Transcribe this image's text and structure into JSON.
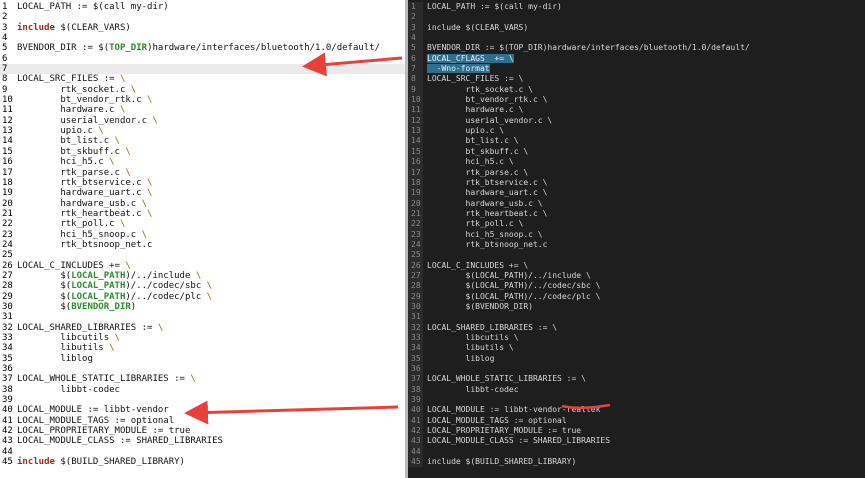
{
  "left_lines": [
    {
      "n": "1",
      "segs": [
        {
          "t": "LOCAL_PATH := $(call my-dir)",
          "c": ""
        }
      ]
    },
    {
      "n": "2",
      "segs": []
    },
    {
      "n": "3",
      "segs": [
        {
          "t": "include",
          "c": "kw"
        },
        {
          "t": " $(CLEAR_VARS)",
          "c": ""
        }
      ]
    },
    {
      "n": "4",
      "segs": []
    },
    {
      "n": "5",
      "segs": [
        {
          "t": "BVENDOR_DIR := $(",
          "c": ""
        },
        {
          "t": "TOP_DIR",
          "c": "var"
        },
        {
          "t": ")hardware/interfaces/bluetooth/1.0/default/",
          "c": ""
        }
      ]
    },
    {
      "n": "6",
      "segs": []
    },
    {
      "n": "7",
      "segs": [],
      "current": true
    },
    {
      "n": "8",
      "segs": [
        {
          "t": "LOCAL_SRC_FILES := ",
          "c": ""
        },
        {
          "t": "\\",
          "c": "bs"
        }
      ]
    },
    {
      "n": "9",
      "segs": [
        {
          "t": "        rtk_socket.c ",
          "c": ""
        },
        {
          "t": "\\",
          "c": "bs"
        }
      ]
    },
    {
      "n": "10",
      "segs": [
        {
          "t": "        bt_vendor_rtk.c ",
          "c": ""
        },
        {
          "t": "\\",
          "c": "bs"
        }
      ]
    },
    {
      "n": "11",
      "segs": [
        {
          "t": "        hardware.c ",
          "c": ""
        },
        {
          "t": "\\",
          "c": "bs"
        }
      ]
    },
    {
      "n": "12",
      "segs": [
        {
          "t": "        userial_vendor.c ",
          "c": ""
        },
        {
          "t": "\\",
          "c": "bs"
        }
      ]
    },
    {
      "n": "13",
      "segs": [
        {
          "t": "        upio.c ",
          "c": ""
        },
        {
          "t": "\\",
          "c": "bs"
        }
      ]
    },
    {
      "n": "14",
      "segs": [
        {
          "t": "        bt_list.c ",
          "c": ""
        },
        {
          "t": "\\",
          "c": "bs"
        }
      ]
    },
    {
      "n": "15",
      "segs": [
        {
          "t": "        bt_skbuff.c ",
          "c": ""
        },
        {
          "t": "\\",
          "c": "bs"
        }
      ]
    },
    {
      "n": "16",
      "segs": [
        {
          "t": "        hci_h5.c ",
          "c": ""
        },
        {
          "t": "\\",
          "c": "bs"
        }
      ]
    },
    {
      "n": "17",
      "segs": [
        {
          "t": "        rtk_parse.c ",
          "c": ""
        },
        {
          "t": "\\",
          "c": "bs"
        }
      ]
    },
    {
      "n": "18",
      "segs": [
        {
          "t": "        rtk_btservice.c ",
          "c": ""
        },
        {
          "t": "\\",
          "c": "bs"
        }
      ]
    },
    {
      "n": "19",
      "segs": [
        {
          "t": "        hardware_uart.c ",
          "c": ""
        },
        {
          "t": "\\",
          "c": "bs"
        }
      ]
    },
    {
      "n": "20",
      "segs": [
        {
          "t": "        hardware_usb.c ",
          "c": ""
        },
        {
          "t": "\\",
          "c": "bs"
        }
      ]
    },
    {
      "n": "21",
      "segs": [
        {
          "t": "        rtk_heartbeat.c ",
          "c": ""
        },
        {
          "t": "\\",
          "c": "bs"
        }
      ]
    },
    {
      "n": "22",
      "segs": [
        {
          "t": "        rtk_poll.c ",
          "c": ""
        },
        {
          "t": "\\",
          "c": "bs"
        }
      ]
    },
    {
      "n": "23",
      "segs": [
        {
          "t": "        hci_h5_snoop.c ",
          "c": ""
        },
        {
          "t": "\\",
          "c": "bs"
        }
      ]
    },
    {
      "n": "24",
      "segs": [
        {
          "t": "        rtk_btsnoop_net.c",
          "c": ""
        }
      ]
    },
    {
      "n": "25",
      "segs": []
    },
    {
      "n": "26",
      "segs": [
        {
          "t": "LOCAL_C_INCLUDES += ",
          "c": ""
        },
        {
          "t": "\\",
          "c": "bs"
        }
      ]
    },
    {
      "n": "27",
      "segs": [
        {
          "t": "        $(",
          "c": ""
        },
        {
          "t": "LOCAL_PATH",
          "c": "var"
        },
        {
          "t": ")/../include ",
          "c": ""
        },
        {
          "t": "\\",
          "c": "bs"
        }
      ]
    },
    {
      "n": "28",
      "segs": [
        {
          "t": "        $(",
          "c": ""
        },
        {
          "t": "LOCAL_PATH",
          "c": "var"
        },
        {
          "t": ")/../codec/sbc ",
          "c": ""
        },
        {
          "t": "\\",
          "c": "bs"
        }
      ]
    },
    {
      "n": "29",
      "segs": [
        {
          "t": "        $(",
          "c": ""
        },
        {
          "t": "LOCAL_PATH",
          "c": "var"
        },
        {
          "t": ")/../codec/plc ",
          "c": ""
        },
        {
          "t": "\\",
          "c": "bs"
        }
      ]
    },
    {
      "n": "30",
      "segs": [
        {
          "t": "        $(",
          "c": ""
        },
        {
          "t": "BVENDOR_DIR",
          "c": "var"
        },
        {
          "t": ")",
          "c": ""
        }
      ]
    },
    {
      "n": "31",
      "segs": []
    },
    {
      "n": "32",
      "segs": [
        {
          "t": "LOCAL_SHARED_LIBRARIES := ",
          "c": ""
        },
        {
          "t": "\\",
          "c": "bs"
        }
      ]
    },
    {
      "n": "33",
      "segs": [
        {
          "t": "        libcutils ",
          "c": ""
        },
        {
          "t": "\\",
          "c": "bs"
        }
      ]
    },
    {
      "n": "34",
      "segs": [
        {
          "t": "        libutils ",
          "c": ""
        },
        {
          "t": "\\",
          "c": "bs"
        }
      ]
    },
    {
      "n": "35",
      "segs": [
        {
          "t": "        liblog",
          "c": ""
        }
      ]
    },
    {
      "n": "36",
      "segs": []
    },
    {
      "n": "37",
      "segs": [
        {
          "t": "LOCAL_WHOLE_STATIC_LIBRARIES := ",
          "c": ""
        },
        {
          "t": "\\",
          "c": "bs"
        }
      ]
    },
    {
      "n": "38",
      "segs": [
        {
          "t": "        libbt-codec",
          "c": ""
        }
      ]
    },
    {
      "n": "39",
      "segs": []
    },
    {
      "n": "40",
      "segs": [
        {
          "t": "LOCAL_MODULE := libbt-vendor",
          "c": ""
        }
      ]
    },
    {
      "n": "41",
      "segs": [
        {
          "t": "LOCAL_MODULE_TAGS := optional",
          "c": ""
        }
      ]
    },
    {
      "n": "42",
      "segs": [
        {
          "t": "LOCAL_PROPRIETARY_MODULE := true",
          "c": ""
        }
      ]
    },
    {
      "n": "43",
      "segs": [
        {
          "t": "LOCAL_MODULE_CLASS := SHARED_LIBRARIES",
          "c": ""
        }
      ]
    },
    {
      "n": "44",
      "segs": []
    },
    {
      "n": "45",
      "segs": [
        {
          "t": "include",
          "c": "kw"
        },
        {
          "t": " $(BUILD_SHARED_LIBRARY)",
          "c": ""
        }
      ]
    }
  ],
  "right_lines": [
    {
      "n": "1",
      "t": "LOCAL_PATH := $(call my-dir)"
    },
    {
      "n": "2",
      "t": ""
    },
    {
      "n": "3",
      "t": "include $(CLEAR_VARS)"
    },
    {
      "n": "4",
      "t": ""
    },
    {
      "n": "5",
      "t": "BVENDOR_DIR := $(TOP_DIR)hardware/interfaces/bluetooth/1.0/default/"
    },
    {
      "n": "6",
      "t": "LOCAL_CFLAGS  += \\",
      "sel": true
    },
    {
      "n": "7",
      "t": "  -Wno-format",
      "sel": true
    },
    {
      "n": "8",
      "t": "LOCAL_SRC_FILES := \\"
    },
    {
      "n": "9",
      "t": "        rtk_socket.c \\"
    },
    {
      "n": "10",
      "t": "        bt_vendor_rtk.c \\"
    },
    {
      "n": "11",
      "t": "        hardware.c \\"
    },
    {
      "n": "12",
      "t": "        userial_vendor.c \\"
    },
    {
      "n": "13",
      "t": "        upio.c \\"
    },
    {
      "n": "14",
      "t": "        bt_list.c \\"
    },
    {
      "n": "15",
      "t": "        bt_skbuff.c \\"
    },
    {
      "n": "16",
      "t": "        hci_h5.c \\"
    },
    {
      "n": "17",
      "t": "        rtk_parse.c \\"
    },
    {
      "n": "18",
      "t": "        rtk_btservice.c \\"
    },
    {
      "n": "19",
      "t": "        hardware_uart.c \\"
    },
    {
      "n": "20",
      "t": "        hardware_usb.c \\"
    },
    {
      "n": "21",
      "t": "        rtk_heartbeat.c \\"
    },
    {
      "n": "22",
      "t": "        rtk_poll.c \\"
    },
    {
      "n": "23",
      "t": "        hci_h5_snoop.c \\"
    },
    {
      "n": "24",
      "t": "        rtk_btsnoop_net.c"
    },
    {
      "n": "25",
      "t": ""
    },
    {
      "n": "26",
      "t": "LOCAL_C_INCLUDES += \\"
    },
    {
      "n": "27",
      "t": "        $(LOCAL_PATH)/../include \\"
    },
    {
      "n": "28",
      "t": "        $(LOCAL_PATH)/../codec/sbc \\"
    },
    {
      "n": "29",
      "t": "        $(LOCAL_PATH)/../codec/plc \\"
    },
    {
      "n": "30",
      "t": "        $(BVENDOR_DIR)"
    },
    {
      "n": "31",
      "t": ""
    },
    {
      "n": "32",
      "t": "LOCAL_SHARED_LIBRARIES := \\"
    },
    {
      "n": "33",
      "t": "        libcutils \\"
    },
    {
      "n": "34",
      "t": "        libutils \\"
    },
    {
      "n": "35",
      "t": "        liblog"
    },
    {
      "n": "36",
      "t": ""
    },
    {
      "n": "37",
      "t": "LOCAL_WHOLE_STATIC_LIBRARIES := \\"
    },
    {
      "n": "38",
      "t": "        libbt-codec"
    },
    {
      "n": "39",
      "t": ""
    },
    {
      "n": "40",
      "t": "LOCAL_MODULE := libbt-vendor-realtek"
    },
    {
      "n": "41",
      "t": "LOCAL_MODULE_TAGS := optional"
    },
    {
      "n": "42",
      "t": "LOCAL_PROPRIETARY_MODULE := true"
    },
    {
      "n": "43",
      "t": "LOCAL_MODULE_CLASS := SHARED_LIBRARIES"
    },
    {
      "n": "44",
      "t": ""
    },
    {
      "n": "45",
      "t": "include $(BUILD_SHARED_LIBRARY)"
    }
  ],
  "annotation_color": "#e8413c"
}
